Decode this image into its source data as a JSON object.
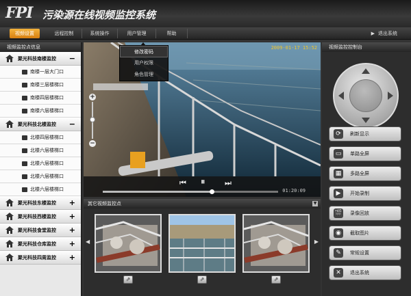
{
  "app": {
    "logo": "FPI",
    "title": "污染源在线视频监控系统"
  },
  "menu": {
    "items": [
      "视频设置",
      "远程控制",
      "系统操作",
      "用户管理",
      "帮助"
    ],
    "exit": "退出系统"
  },
  "left_panel": {
    "title": "视频监控点信息",
    "groups": [
      {
        "name": "聚光科技南楼监控",
        "expanded": true,
        "cameras": [
          "南楼一层大门口",
          "南楼三层楼梯口",
          "南楼四层楼梯口",
          "南楼六层楼梯口"
        ]
      },
      {
        "name": "聚光科技北楼监控",
        "expanded": true,
        "cameras": [
          "北楼四层楼梯口",
          "北楼六层楼梯口",
          "北楼六层楼梯口",
          "北楼六层楼梯口",
          "北楼六层楼梯口"
        ]
      },
      {
        "name": "聚光科技东楼监控",
        "expanded": false,
        "cameras": []
      },
      {
        "name": "聚光科技西楼监控",
        "expanded": false,
        "cameras": []
      },
      {
        "name": "聚光科技食堂监控",
        "expanded": false,
        "cameras": []
      },
      {
        "name": "聚光科技仓库监控",
        "expanded": false,
        "cameras": []
      },
      {
        "name": "聚光科技四周监控",
        "expanded": false,
        "cameras": []
      }
    ]
  },
  "video": {
    "timestamp": "2009-01-17 15:52",
    "dropdown": [
      "修改密码",
      "用户权限",
      "角色管理"
    ],
    "elapsed": "01:20:09",
    "progress": 0.62
  },
  "thumbs_panel": {
    "title": "其它视频监控点"
  },
  "right_panel": {
    "title": "视频监控控制台",
    "buttons": [
      {
        "label": "刷新显示",
        "icon": "refresh-icon",
        "glyph": "⟳"
      },
      {
        "label": "单路全屏",
        "icon": "single-screen-icon",
        "glyph": "▭"
      },
      {
        "label": "多路全屏",
        "icon": "multi-screen-icon",
        "glyph": "▦"
      },
      {
        "label": "开始录制",
        "icon": "play-record-icon",
        "glyph": "▶"
      },
      {
        "label": "录像回放",
        "icon": "clapper-icon",
        "glyph": "🎬"
      },
      {
        "label": "截取图片",
        "icon": "camera-icon",
        "glyph": "◉"
      },
      {
        "label": "常规设置",
        "icon": "wrench-icon",
        "glyph": "✎"
      },
      {
        "label": "退出系统",
        "icon": "exit-icon",
        "glyph": "✕"
      }
    ]
  },
  "colors": {
    "accent": "#e8951f",
    "timestamp": "#f2c62b"
  }
}
